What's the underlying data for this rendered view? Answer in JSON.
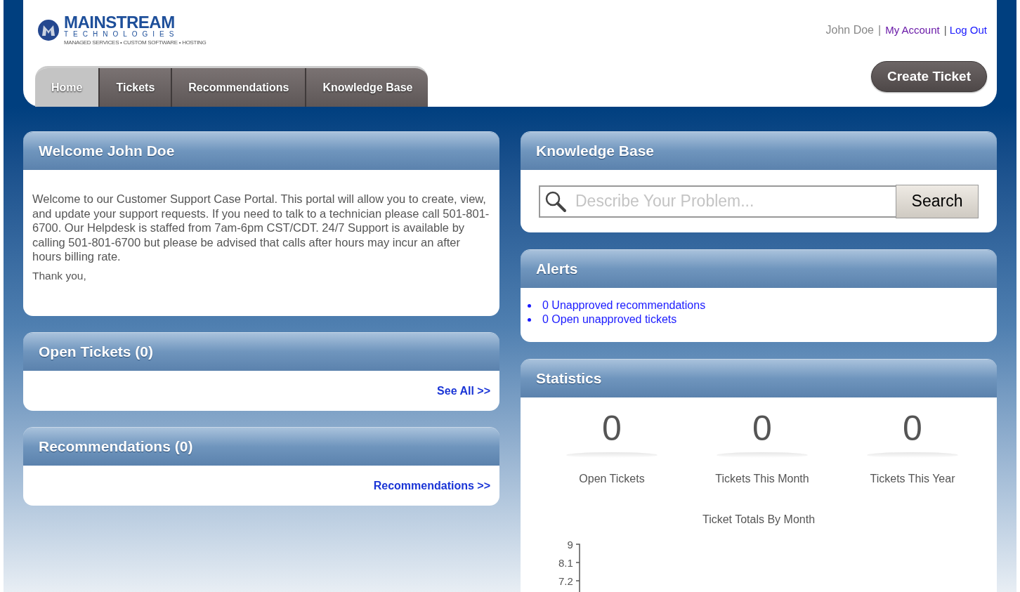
{
  "logo": {
    "name": "MAINSTREAM",
    "sub": "TECHNOLOGIES",
    "tagline": "MANAGED SERVICES • CUSTOM SOFTWARE • HOSTING"
  },
  "user": {
    "name": "John Doe",
    "separator": "|",
    "links": [
      {
        "label": "My Account",
        "visited": true
      },
      {
        "label": "Log Out",
        "visited": false
      }
    ]
  },
  "tabs": [
    {
      "label": "Home",
      "selected": true
    },
    {
      "label": "Tickets",
      "selected": false
    },
    {
      "label": "Recommendations",
      "selected": false
    },
    {
      "label": "Knowledge Base",
      "selected": false
    }
  ],
  "create_button": "Create Ticket",
  "welcome": {
    "title": "Welcome John Doe",
    "text": "Welcome to our Customer Support Case Portal.  This portal will allow you to create, view, and update your support requests.  If you need to talk to a technician please call 501-801-6700.  Our Helpdesk is staffed from 7am-6pm CST/CDT. 24/7 Support is available by calling 501-801-6700 but please be advised that calls after hours may incur an after hours billing rate.",
    "closing": "Thank you,"
  },
  "open_tickets": {
    "title": "Open Tickets (0)",
    "link": "See All >>"
  },
  "recommendations": {
    "title": "Recommendations (0)",
    "link": "Recommendations >>"
  },
  "knowledge_base": {
    "title": "Knowledge Base",
    "placeholder": "Describe Your Problem...",
    "button": "Search"
  },
  "alerts": {
    "title": "Alerts",
    "items": [
      "0 Unapproved recommendations",
      "0 Open unapproved tickets"
    ]
  },
  "statistics": {
    "title": "Statistics",
    "stats": [
      {
        "value": "0",
        "label": "Open Tickets"
      },
      {
        "value": "0",
        "label": "Tickets This Month"
      },
      {
        "value": "0",
        "label": "Tickets This Year"
      }
    ],
    "chart": {
      "title": "Ticket Totals By Month",
      "y_ticks": [
        "9",
        "8.1",
        "7.2"
      ]
    }
  }
}
